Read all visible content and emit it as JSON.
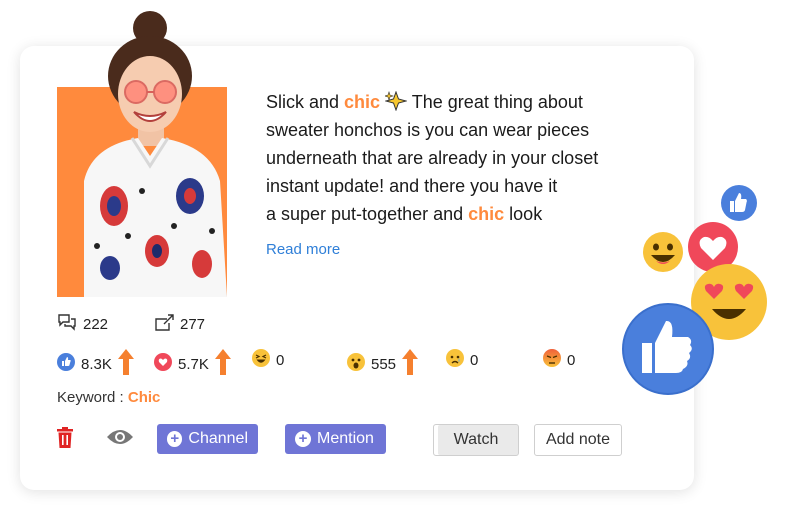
{
  "post": {
    "line1_pre": "Slick and ",
    "line1_hl": "chic",
    "line1_post": " The great thing about",
    "line2": "sweater honchos is you can wear pieces",
    "line3": "underneath that are already in your closet",
    "line4": "instant update! and there you have it",
    "line5_pre": "a super put-together and ",
    "line5_hl": "chic",
    "line5_post": " look",
    "read_more": "Read more"
  },
  "stats": {
    "comments": "222",
    "shares": "277"
  },
  "reactions": {
    "like": "8.3K",
    "love": "5.7K",
    "haha": "0",
    "wow": "555",
    "sad": "0",
    "angry": "0"
  },
  "keyword": {
    "label": "Keyword : ",
    "value": "Chic"
  },
  "actions": {
    "channel": "Channel",
    "mention": "Mention",
    "watch": "Watch",
    "add_note": "Add note"
  },
  "colors": {
    "accent_orange": "#ff8a3d",
    "button_purple": "#6f75d6",
    "link_blue": "#2f7fd8",
    "delete_red": "#e02424",
    "like_blue": "#4a7fdc",
    "love_red": "#f0485a"
  }
}
